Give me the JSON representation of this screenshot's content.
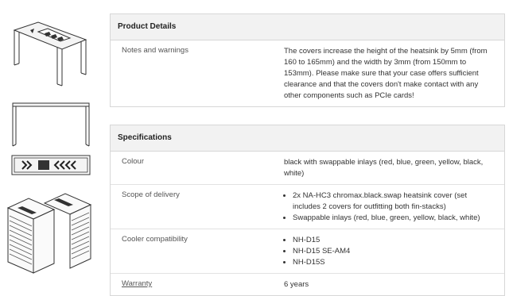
{
  "product_details": {
    "heading": "Product Details",
    "rows": [
      {
        "label": "Notes and warnings",
        "value": "The covers increase the height of the heatsink by 5mm (from 160 to 165mm) and the width by 3mm (from 150mm to 153mm). Please make sure that your case offers sufficient clearance and that the covers don't make contact with any other components such as PCIe cards!"
      }
    ]
  },
  "specifications": {
    "heading": "Specifications",
    "colour": {
      "label": "Colour",
      "value": "black with swappable inlays (red, blue, green, yellow, black, white)"
    },
    "scope": {
      "label": "Scope of delivery",
      "items": [
        "2x NA-HC3 chromax.black.swap heatsink cover (set includes 2 covers for outfitting both fin-stacks)",
        "Swappable inlays (red, blue, green, yellow, black, white)"
      ]
    },
    "compat": {
      "label": "Cooler compatibility",
      "items": [
        "NH-D15",
        "NH-D15 SE-AM4",
        "NH-D15S"
      ]
    },
    "warranty": {
      "label": "Warranty",
      "value": "6 years"
    }
  },
  "icons": [
    "cover-perspective-icon",
    "cover-side-icon",
    "cover-top-icon",
    "cooler-with-covers-icon"
  ]
}
